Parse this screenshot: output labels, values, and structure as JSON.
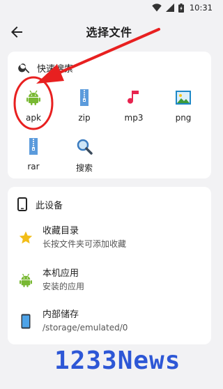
{
  "status_bar": {
    "time": "10:31"
  },
  "app_bar": {
    "title": "选择文件"
  },
  "quick_search": {
    "label": "快速搜索",
    "items": [
      {
        "label": "apk",
        "icon": "android-icon"
      },
      {
        "label": "zip",
        "icon": "zip-file-icon"
      },
      {
        "label": "mp3",
        "icon": "music-note-icon"
      },
      {
        "label": "png",
        "icon": "image-icon"
      },
      {
        "label": "rar",
        "icon": "rar-file-icon"
      },
      {
        "label": "搜索",
        "icon": "search-icon"
      }
    ]
  },
  "device": {
    "label": "此设备",
    "items": [
      {
        "title": "收藏目录",
        "subtitle": "长按文件夹可添加收藏",
        "icon": "star-icon"
      },
      {
        "title": "本机应用",
        "subtitle": "安装的应用",
        "icon": "android-icon"
      },
      {
        "title": "内部储存",
        "subtitle": "/storage/emulated/0",
        "icon": "phone-icon"
      }
    ]
  },
  "watermark": "1233News",
  "colors": {
    "android": "#78b832",
    "zip": "#5b9bdc",
    "music": "#e7244f",
    "star": "#f2bd18",
    "annotation": "#e82020",
    "watermark": "#2d57d6"
  }
}
